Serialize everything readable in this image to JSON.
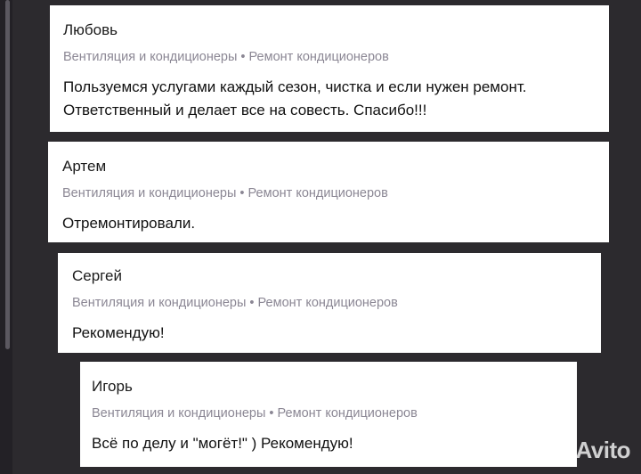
{
  "reviews": [
    {
      "author": "Любовь",
      "category": "Вентиляция и кондиционеры • Ремонт кондиционеров",
      "text_lines": [
        "Пользуемся услугами каждый сезон, чистка и если нужен ремонт.",
        "Ответственный и делает все на совесть. Спасибо!!!"
      ]
    },
    {
      "author": "Артем",
      "category": "Вентиляция и кондиционеры • Ремонт кондиционеров",
      "text_lines": [
        "Отремонтировали."
      ]
    },
    {
      "author": "Сергей",
      "category": "Вентиляция и кондиционеры • Ремонт кондиционеров",
      "text_lines": [
        "Рекомендую!"
      ]
    },
    {
      "author": "Игорь",
      "category": "Вентиляция и кондиционеры • Ремонт кондиционеров",
      "text_lines": [
        "Всё по делу и \"могёт!\" ) Рекомендую!"
      ]
    }
  ],
  "watermark": {
    "text": "Avito",
    "icon": "avito-logo-icon"
  },
  "colors": {
    "background": "#2c2a2e",
    "card": "#ffffff",
    "category_text": "#8b8794"
  }
}
